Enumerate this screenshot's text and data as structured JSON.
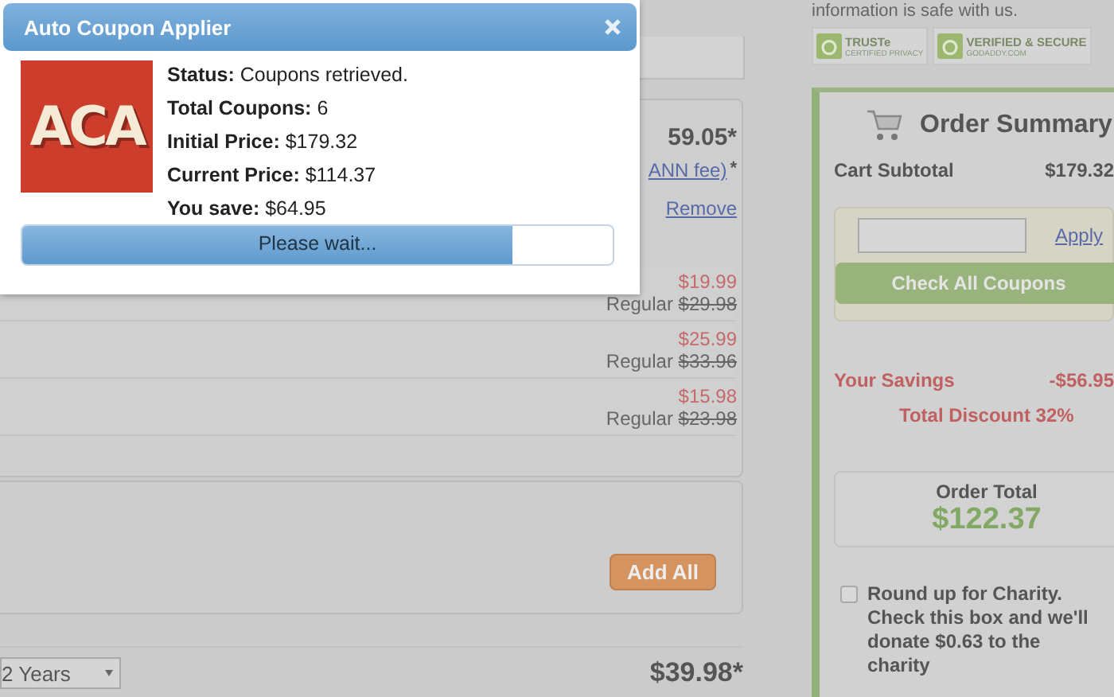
{
  "dialog": {
    "title": "Auto Coupon Applier",
    "logo": "ACA",
    "lines": [
      "**Status:** Coupons retrieved.",
      "**Total Coupons:** 6",
      "**Initial Price:** $179.32",
      "**Current Price:** $114.37",
      "**You save:** $64.95"
    ],
    "progress": {
      "label": "Please wait...",
      "level": 0.83
    }
  },
  "cart": {
    "price": "59.05*",
    "fee_link": "ANN fee)",
    "fee_mark": "*",
    "remove": "Remove",
    "items": [
      {
        "sale": "$19.99",
        "regular_label": "Regular",
        "regular": "$29.98"
      },
      {
        "sale": "$25.99",
        "regular_label": "Regular",
        "regular": "$33.96"
      },
      {
        "sale": "$15.98",
        "regular_label": "Regular",
        "regular": "$23.98"
      }
    ],
    "add_all": "Add All",
    "term": "2 Years",
    "term_price": "$39.98*"
  },
  "sidebar": {
    "notice": "information is safe with us.",
    "badges": [
      {
        "name": "TRUSTe",
        "sub": "CERTIFIED PRIVACY"
      },
      {
        "name": "VERIFIED & SECURE",
        "sub": "GODADDY.COM"
      }
    ],
    "title": "Order Summary",
    "subtotal_label": "Cart Subtotal",
    "subtotal": "$179.32",
    "apply": "Apply",
    "check_all": "Check All Coupons",
    "savings_label": "Your Savings",
    "savings": "-$56.95",
    "discount": "Total Discount 32%",
    "total_label": "Order Total",
    "total": "$122.37",
    "charity": {
      "checked": false,
      "text": "Round up for Charity. Check this box and we'll donate $0.63 to the charity"
    }
  }
}
